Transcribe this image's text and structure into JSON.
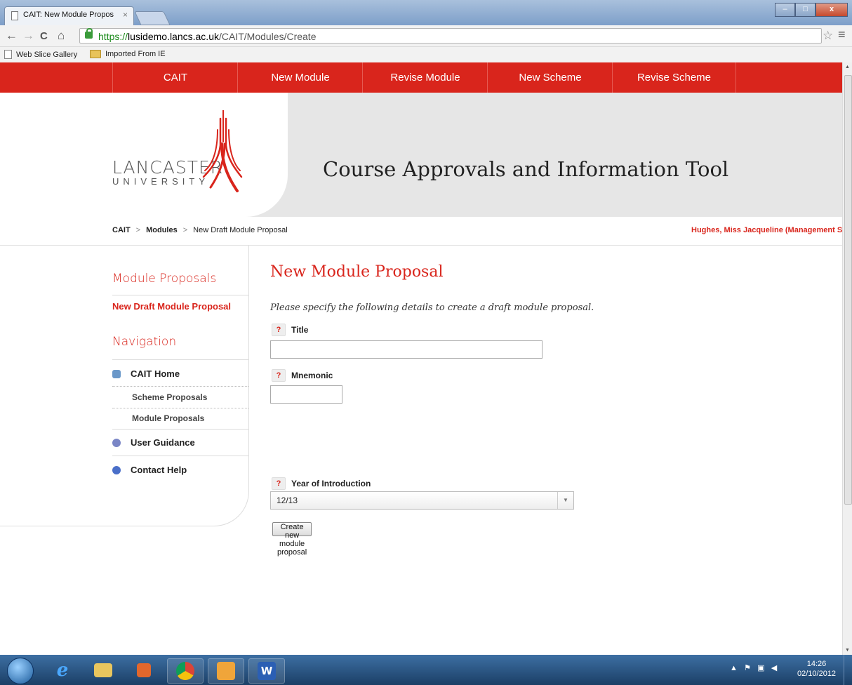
{
  "browser": {
    "tab_title": "CAIT: New Module Propos",
    "tab_close": "×",
    "url_scheme": "https://",
    "url_host": "lusidemo.lancs.ac.uk",
    "url_path": "/CAIT/Modules/Create",
    "back": "←",
    "forward": "→",
    "reload": "C",
    "home": "⌂",
    "star": "☆",
    "menu": "≡",
    "window_minimize": "–",
    "window_maximize": "□",
    "window_close": "x",
    "bookmarks": [
      "Web Slice Gallery",
      "Imported From IE"
    ]
  },
  "top_nav": [
    "CAIT",
    "New Module",
    "Revise Module",
    "New Scheme",
    "Revise Scheme"
  ],
  "header": {
    "logo_line1": "LANCASTER",
    "logo_line2": "UNIVERSITY",
    "title": "Course Approvals and Information Tool"
  },
  "breadcrumb": {
    "items": [
      "CAIT",
      "Modules",
      "New Draft Module Proposal"
    ],
    "separator": ">",
    "user": "Hughes, Miss Jacqueline (Management Science)"
  },
  "sidebar": {
    "section1": "Module Proposals",
    "active_item": "New Draft Module Proposal",
    "section2": "Navigation",
    "items": [
      {
        "label": "CAIT Home",
        "icon": "home-icon"
      },
      {
        "label": "Scheme Proposals"
      },
      {
        "label": "Module Proposals"
      },
      {
        "label": "User Guidance",
        "icon": "info-icon"
      },
      {
        "label": "Contact Help",
        "icon": "help-circle-icon"
      }
    ]
  },
  "main": {
    "title": "New Module Proposal",
    "intro": "Please specify the following details to create a draft module proposal.",
    "help_glyph": "?",
    "fields": {
      "title_label": "Title",
      "title_value": "",
      "mnemonic_label": "Mnemonic",
      "mnemonic_value": "",
      "year_label": "Year of Introduction",
      "year_value": "12/13"
    },
    "submit_label": "Create new module proposal"
  },
  "taskbar": {
    "time": "14:26",
    "date": "02/10/2012",
    "apps": [
      "ie-icon",
      "explorer-icon",
      "office-icon",
      "chrome-icon",
      "outlook-icon",
      "word-icon"
    ]
  },
  "colors": {
    "accent": "#d9251c",
    "header_bg": "#e6e6e6"
  }
}
